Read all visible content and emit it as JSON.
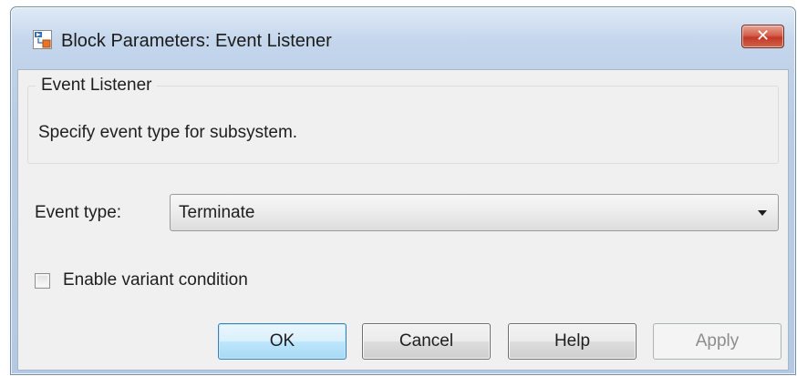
{
  "window": {
    "title": "Block Parameters: Event Listener",
    "close_label": "✕"
  },
  "group": {
    "title": "Event Listener",
    "description": "Specify event type for subsystem."
  },
  "event_type": {
    "label": "Event type:",
    "selected": "Terminate"
  },
  "variant_condition": {
    "label": "Enable variant condition",
    "checked": false
  },
  "buttons": {
    "ok": "OK",
    "cancel": "Cancel",
    "help": "Help",
    "apply": "Apply"
  },
  "icons": {
    "app": "simulink-block-icon",
    "close": "close-icon",
    "dropdown": "chevron-down-icon"
  },
  "colors": {
    "close_button": "#c2382a",
    "default_button_border": "#3c7fb1",
    "window_frame": "#c4d6ec"
  }
}
